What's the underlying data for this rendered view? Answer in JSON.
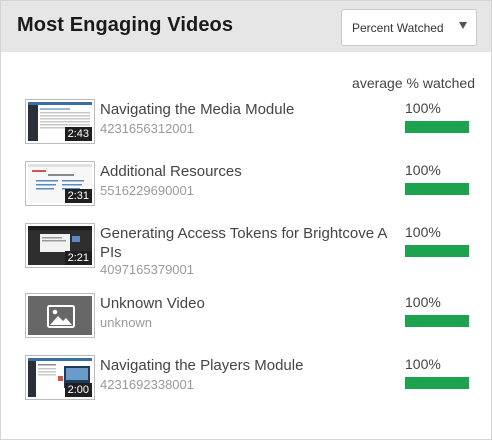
{
  "widget": {
    "title": "Most Engaging Videos",
    "sort_select": {
      "selected": "Percent Watched"
    },
    "column_header": "average % watched"
  },
  "colors": {
    "bar": "#1fa24f",
    "header_bg": "#e6e6e6"
  },
  "videos": [
    {
      "title": "Navigating the Media Module",
      "id": "4231656312001",
      "duration": "2:43",
      "percent_label": "100%",
      "percent": 100,
      "thumb": "media-module"
    },
    {
      "title": "Additional Resources",
      "id": "5516229690001",
      "duration": "2:31",
      "percent_label": "100%",
      "percent": 100,
      "thumb": "resources"
    },
    {
      "title": "Generating Access Tokens for Brightcove A PIs",
      "id": "4097165379001",
      "duration": "2:21",
      "percent_label": "100%",
      "percent": 100,
      "thumb": "tokens"
    },
    {
      "title": "Unknown Video",
      "id": "unknown",
      "duration": "",
      "percent_label": "100%",
      "percent": 100,
      "thumb": "placeholder-image-icon"
    },
    {
      "title": "Navigating the Players Module",
      "id": "4231692338001",
      "duration": "2:00",
      "percent_label": "100%",
      "percent": 100,
      "thumb": "players-module"
    }
  ]
}
